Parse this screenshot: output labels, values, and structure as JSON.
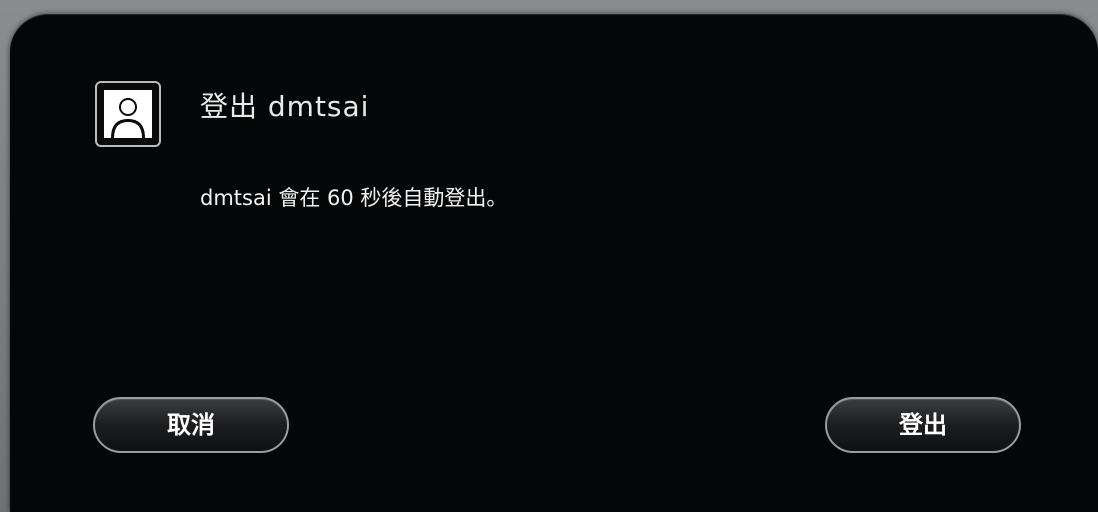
{
  "dialog": {
    "title": "登出 dmtsai",
    "message": "dmtsai 會在 60 秒後自動登出。",
    "avatar_icon": "user-icon"
  },
  "buttons": {
    "cancel_label": "取消",
    "logout_label": "登出"
  }
}
